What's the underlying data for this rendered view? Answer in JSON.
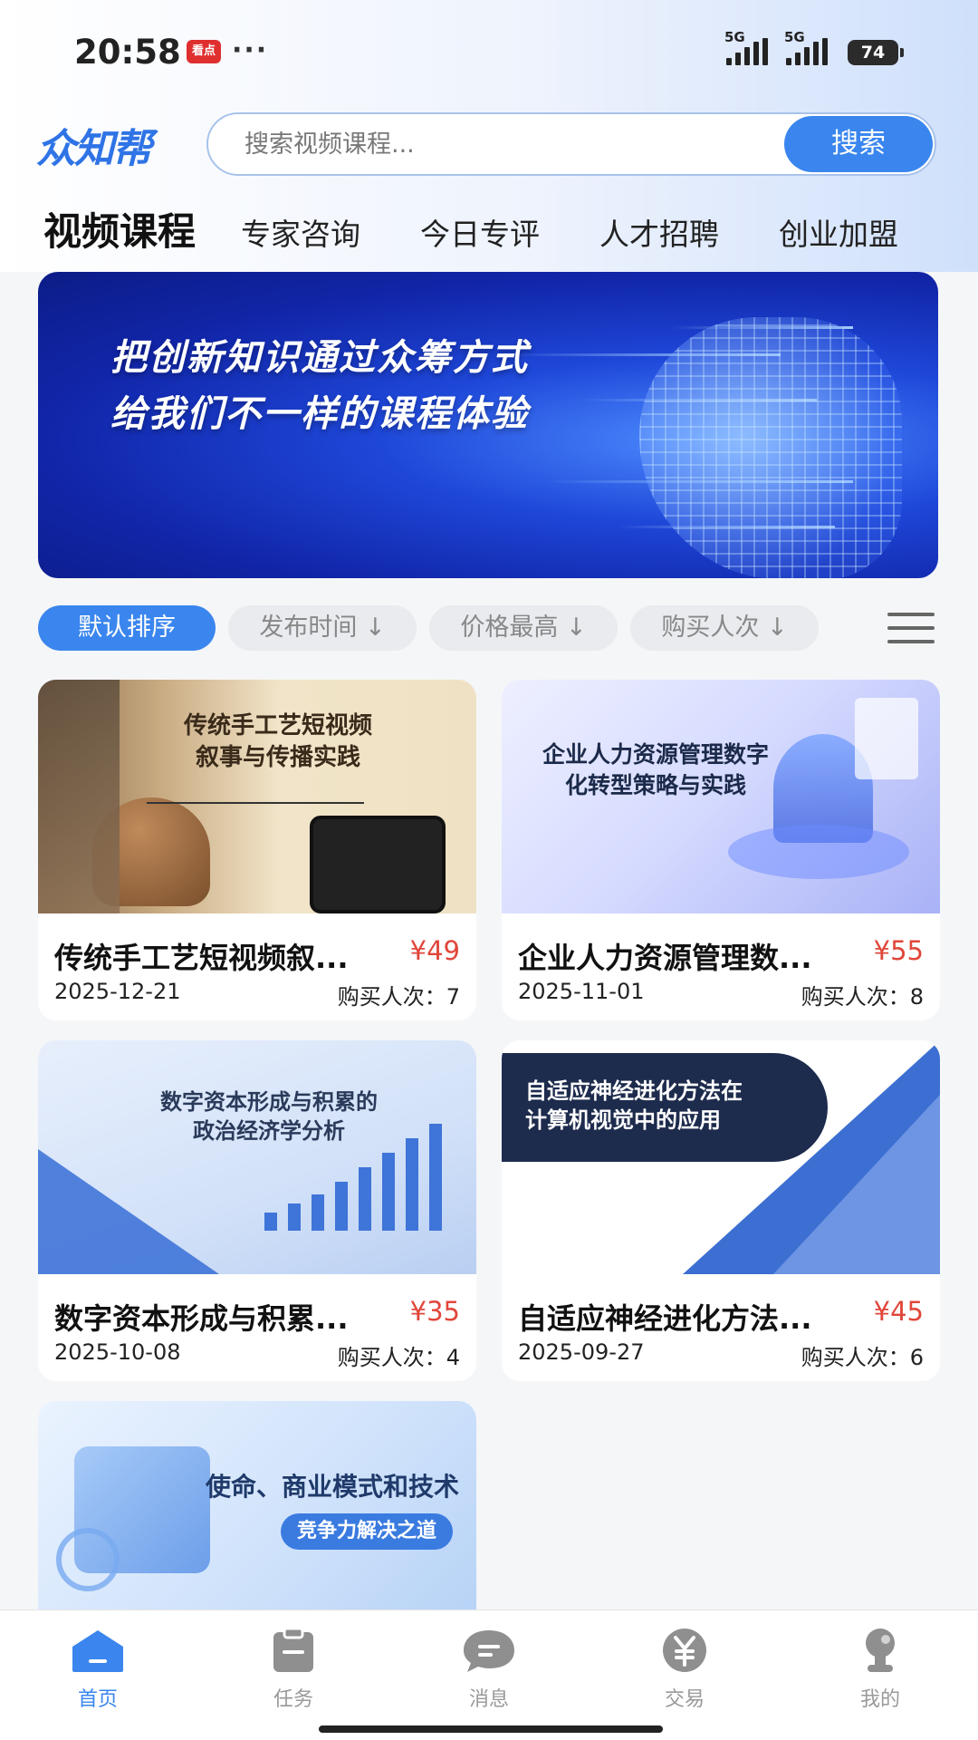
{
  "status_bar": {
    "time": "20:58",
    "app_badge": "看点",
    "dots": "···",
    "network1": "5G",
    "network2": "5G",
    "battery": "74"
  },
  "header": {
    "logo": "众知帮",
    "search_placeholder": "搜索视频课程...",
    "search_button": "搜索"
  },
  "tabs": [
    {
      "label": "视频课程",
      "active": true
    },
    {
      "label": "专家咨询",
      "active": false
    },
    {
      "label": "今日专评",
      "active": false
    },
    {
      "label": "人才招聘",
      "active": false
    },
    {
      "label": "创业加盟",
      "active": false
    }
  ],
  "banner": {
    "line1": "把创新知识通过众筹方式",
    "line2": "给我们不一样的课程体验"
  },
  "filters": [
    {
      "label": "默认排序",
      "active": true
    },
    {
      "label": "发布时间 ↓",
      "active": false
    },
    {
      "label": "价格最高 ↓",
      "active": false
    },
    {
      "label": "购买人次 ↓",
      "active": false
    }
  ],
  "courses": [
    {
      "thumb_text": "传统手工艺短视频\n叙事与传播实践",
      "title": "传统手工艺短视频叙...",
      "price": "¥49",
      "date": "2025-12-21",
      "buy": "购买人次：7"
    },
    {
      "thumb_text": "企业人力资源管理数字\n化转型策略与实践",
      "title": "企业人力资源管理数...",
      "price": "¥55",
      "date": "2025-11-01",
      "buy": "购买人次：8"
    },
    {
      "thumb_text": "数字资本形成与积累的\n政治经济学分析",
      "title": "数字资本形成与积累...",
      "price": "¥35",
      "date": "2025-10-08",
      "buy": "购买人次：4"
    },
    {
      "thumb_text": "自适应神经进化方法在\n计算机视觉中的应用",
      "title": "自适应神经进化方法...",
      "price": "¥45",
      "date": "2025-09-27",
      "buy": "购买人次：6"
    },
    {
      "thumb_text": "使命、商业模式和技术",
      "thumb_sub": "竞争力解决之道"
    }
  ],
  "bottom_nav": [
    {
      "label": "首页",
      "icon": "home-icon",
      "active": true
    },
    {
      "label": "任务",
      "icon": "clipboard-icon",
      "active": false
    },
    {
      "label": "消息",
      "icon": "chat-icon",
      "active": false
    },
    {
      "label": "交易",
      "icon": "yuan-icon",
      "active": false
    },
    {
      "label": "我的",
      "icon": "user-icon",
      "active": false
    }
  ],
  "colors": {
    "accent": "#3a86ee",
    "price": "#e0463a"
  }
}
